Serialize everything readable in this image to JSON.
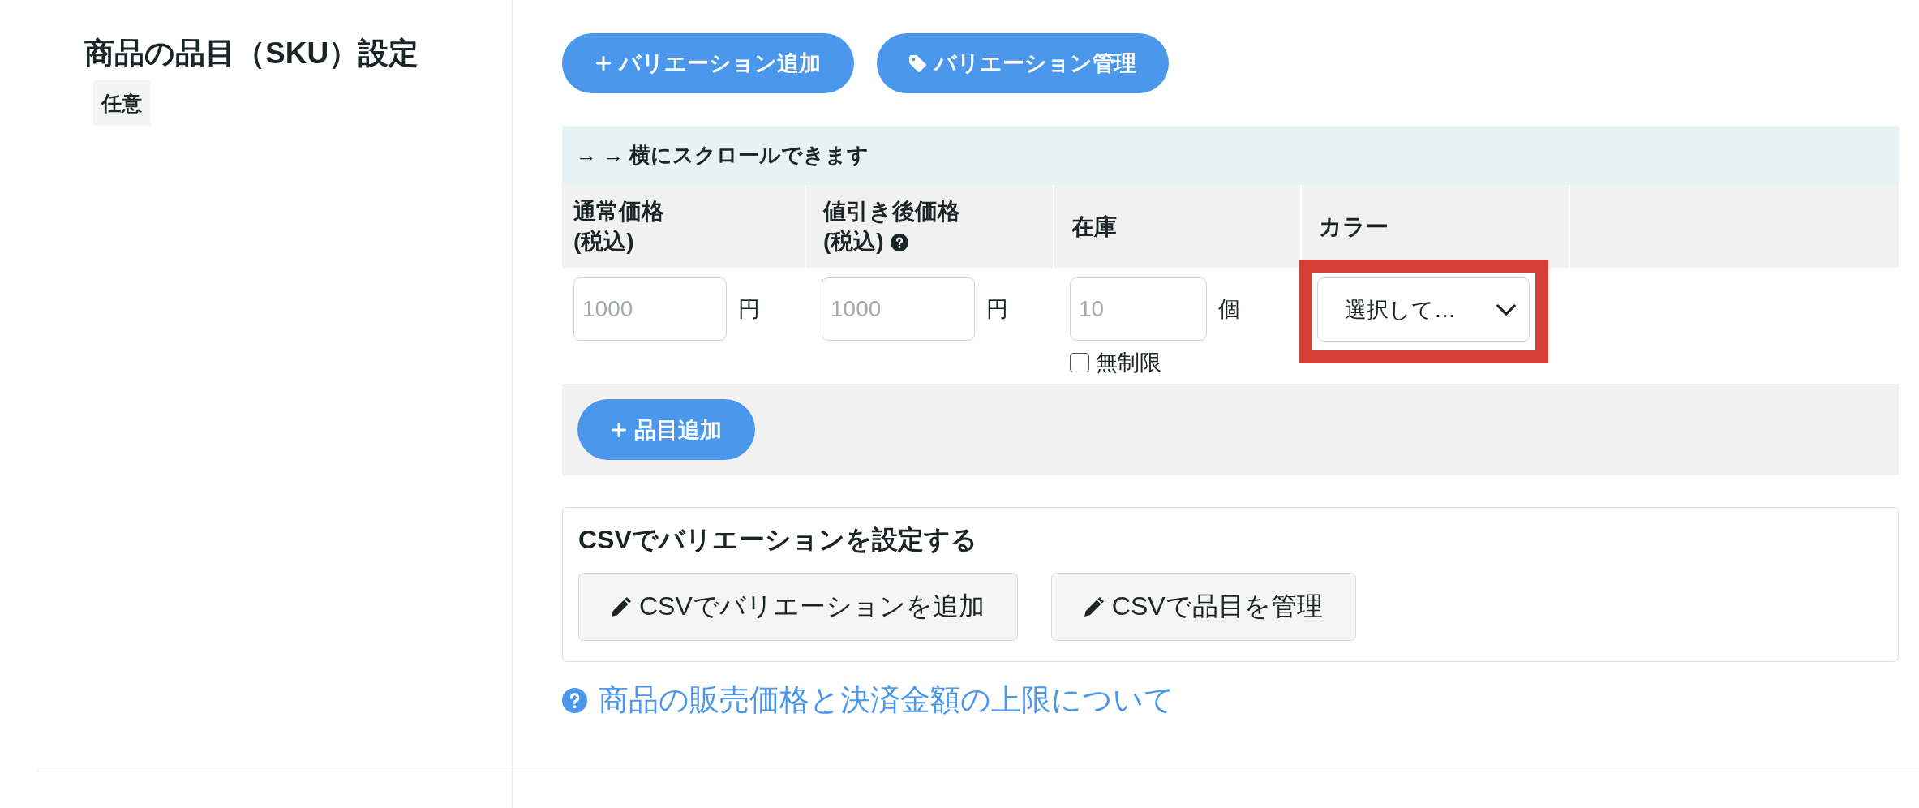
{
  "section": {
    "title": "商品の品目（SKU）設定",
    "badge": "任意"
  },
  "toolbar": {
    "buttons": [
      {
        "kind": "add",
        "label": "バリエーション追加"
      },
      {
        "kind": "tag",
        "label": "バリエーション管理"
      }
    ]
  },
  "sku_table": {
    "scroll_hint": "→ → 横にスクロールできます",
    "columns": [
      {
        "label": "通常価格\n(税込)",
        "help": false
      },
      {
        "label": "値引き後価格\n(税込)",
        "help": true
      },
      {
        "label": "在庫",
        "help": false
      },
      {
        "label": "カラー",
        "help": false
      }
    ],
    "rows": [
      {
        "cells": [
          {
            "kind": "number",
            "placeholder": "1000",
            "unit": "円"
          },
          {
            "kind": "number",
            "placeholder": "1000",
            "unit": "円"
          },
          {
            "kind": "stock",
            "placeholder": "10",
            "unit": "個",
            "unlimited": {
              "label": "無制限",
              "checked": false
            }
          },
          {
            "kind": "select",
            "value": "選択して…",
            "highlighted": true
          }
        ]
      }
    ],
    "add_item_button": {
      "label": "品目追加"
    }
  },
  "csv": {
    "title": "CSVでバリエーションを設定する",
    "buttons": [
      {
        "label": "CSVでバリエーションを追加"
      },
      {
        "label": "CSVで品目を管理"
      }
    ]
  },
  "help_link": {
    "label": "商品の販売価格と決済金額の上限について"
  }
}
